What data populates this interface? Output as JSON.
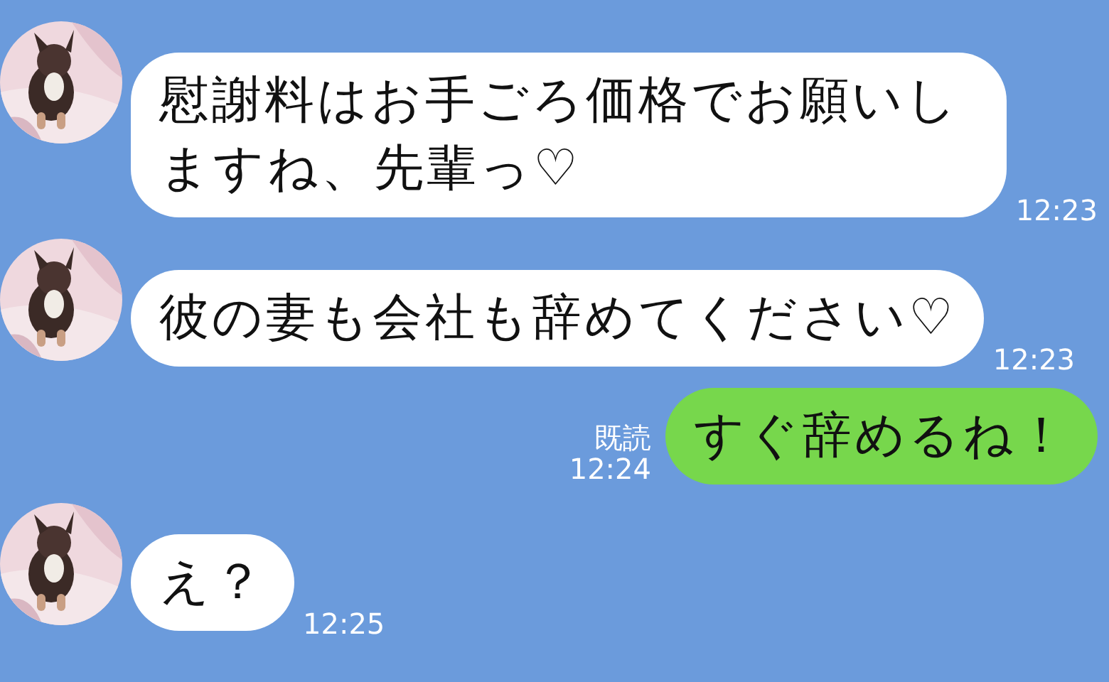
{
  "messages": [
    {
      "kind": "received",
      "text": "慰謝料はお手ごろ価格でお願いしますね、先輩っ♡",
      "time": "12:23"
    },
    {
      "kind": "received",
      "text": "彼の妻も会社も辞めてください♡",
      "time": "12:23"
    },
    {
      "kind": "sent",
      "read": "既読",
      "text": "すぐ辞めるね！",
      "time": "12:24"
    },
    {
      "kind": "received",
      "text": "え？",
      "time": "12:25"
    }
  ]
}
